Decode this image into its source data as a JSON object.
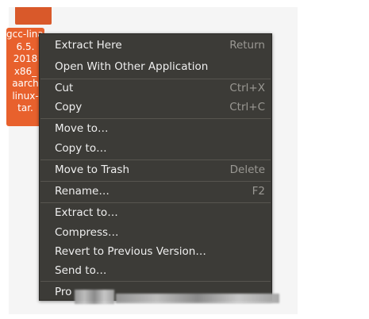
{
  "file": {
    "lines": [
      "gcc-linaro",
      "6.5.",
      "2018",
      "x86_",
      "aarch",
      "linux-",
      "tar."
    ]
  },
  "menu": {
    "items": [
      {
        "label": "Extract Here",
        "accel": "Return"
      },
      {
        "label": "Open With Other Application",
        "accel": ""
      },
      {
        "label": "Cut",
        "accel": "Ctrl+X"
      },
      {
        "label": "Copy",
        "accel": "Ctrl+C"
      },
      {
        "label": "Move to…",
        "accel": ""
      },
      {
        "label": "Copy to…",
        "accel": ""
      },
      {
        "label": "Move to Trash",
        "accel": "Delete"
      },
      {
        "label": "Rename…",
        "accel": "F2"
      },
      {
        "label": "Extract to…",
        "accel": ""
      },
      {
        "label": "Compress…",
        "accel": ""
      },
      {
        "label": "Revert to Previous Version…",
        "accel": ""
      },
      {
        "label": "Send to…",
        "accel": ""
      },
      {
        "label": "Pro",
        "accel": ""
      }
    ]
  },
  "colors": {
    "menu_bg": "#3c3b37",
    "file_accent": "#e8612d"
  }
}
